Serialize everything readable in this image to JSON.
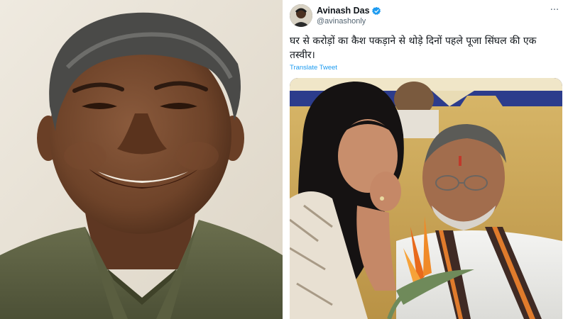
{
  "tweet": {
    "display_name": "Avinash Das",
    "handle": "@avinashonly",
    "text": "घर से करोड़ों का कैश पकड़ाने से थोड़े दिनों पहले पूजा सिंघल की एक तस्वीर।",
    "translate_label": "Translate Tweet",
    "more_icon": "more-horizontal-icon",
    "verified_icon": "verified-badge-icon"
  },
  "colors": {
    "link_blue": "#1d9bf0",
    "text_primary": "#0f1419",
    "text_secondary": "#536471"
  }
}
